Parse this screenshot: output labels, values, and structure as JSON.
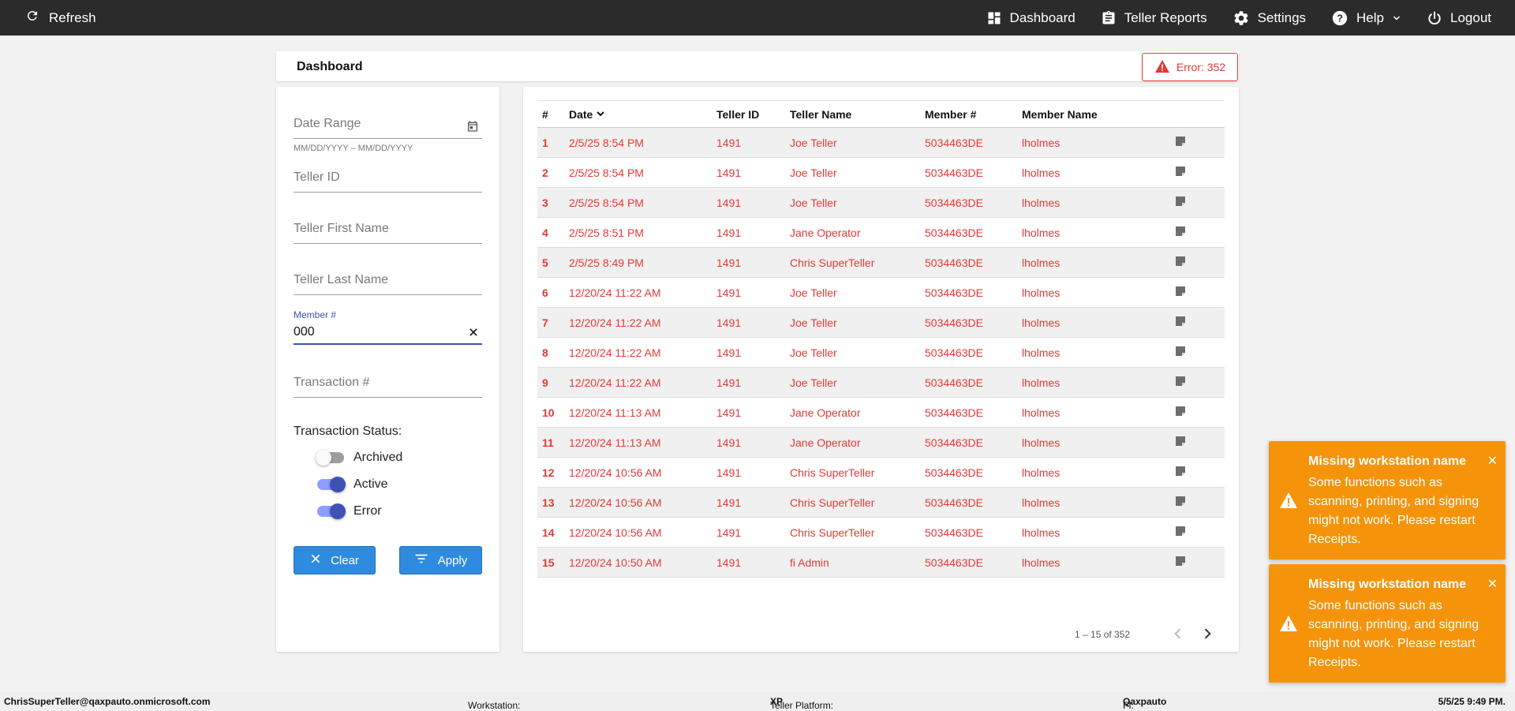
{
  "topbar": {
    "refresh_label": "Refresh",
    "nav": {
      "dashboard": "Dashboard",
      "teller_reports": "Teller Reports",
      "settings": "Settings",
      "help": "Help",
      "logout": "Logout"
    }
  },
  "header": {
    "title": "Dashboard",
    "error_badge": "Error: 352"
  },
  "filters": {
    "date_range_placeholder": "Date Range",
    "date_hint": "MM/DD/YYYY – MM/DD/YYYY",
    "teller_id_placeholder": "Teller ID",
    "teller_first_placeholder": "Teller First Name",
    "teller_last_placeholder": "Teller Last Name",
    "member_label": "Member #",
    "member_value": "000",
    "transaction_placeholder": "Transaction #",
    "status_label": "Transaction Status:",
    "toggles": {
      "archived": {
        "label": "Archived",
        "on": false
      },
      "active": {
        "label": "Active",
        "on": true
      },
      "error": {
        "label": "Error",
        "on": true
      }
    },
    "clear_label": "Clear",
    "apply_label": "Apply"
  },
  "table": {
    "headers": [
      "#",
      "Date",
      "Teller ID",
      "Teller Name",
      "Member #",
      "Member Name"
    ],
    "rows": [
      [
        "1",
        "2/5/25 8:54 PM",
        "1491",
        "Joe Teller",
        "5034463DE",
        "lholmes"
      ],
      [
        "2",
        "2/5/25 8:54 PM",
        "1491",
        "Joe Teller",
        "5034463DE",
        "lholmes"
      ],
      [
        "3",
        "2/5/25 8:54 PM",
        "1491",
        "Joe Teller",
        "5034463DE",
        "lholmes"
      ],
      [
        "4",
        "2/5/25 8:51 PM",
        "1491",
        "Jane Operator",
        "5034463DE",
        "lholmes"
      ],
      [
        "5",
        "2/5/25 8:49 PM",
        "1491",
        "Chris SuperTeller",
        "5034463DE",
        "lholmes"
      ],
      [
        "6",
        "12/20/24 11:22 AM",
        "1491",
        "Joe Teller",
        "5034463DE",
        "lholmes"
      ],
      [
        "7",
        "12/20/24 11:22 AM",
        "1491",
        "Joe Teller",
        "5034463DE",
        "lholmes"
      ],
      [
        "8",
        "12/20/24 11:22 AM",
        "1491",
        "Joe Teller",
        "5034463DE",
        "lholmes"
      ],
      [
        "9",
        "12/20/24 11:22 AM",
        "1491",
        "Joe Teller",
        "5034463DE",
        "lholmes"
      ],
      [
        "10",
        "12/20/24 11:13 AM",
        "1491",
        "Jane Operator",
        "5034463DE",
        "lholmes"
      ],
      [
        "11",
        "12/20/24 11:13 AM",
        "1491",
        "Jane Operator",
        "5034463DE",
        "lholmes"
      ],
      [
        "12",
        "12/20/24 10:56 AM",
        "1491",
        "Chris SuperTeller",
        "5034463DE",
        "lholmes"
      ],
      [
        "13",
        "12/20/24 10:56 AM",
        "1491",
        "Chris SuperTeller",
        "5034463DE",
        "lholmes"
      ],
      [
        "14",
        "12/20/24 10:56 AM",
        "1491",
        "Chris SuperTeller",
        "5034463DE",
        "lholmes"
      ],
      [
        "15",
        "12/20/24 10:50 AM",
        "1491",
        "fi Admin",
        "5034463DE",
        "lholmes"
      ]
    ],
    "row_text_color": "#e53935"
  },
  "pager": {
    "range": "1 – 15 of 352"
  },
  "toasts": [
    {
      "title": "Missing workstation name",
      "message": "Some functions such as scanning, printing, and signing might not work. Please restart Receipts."
    },
    {
      "title": "Missing workstation name",
      "message": "Some functions such as scanning, printing, and signing might not work. Please restart Receipts."
    }
  ],
  "footer": {
    "user": "ChrisSuperTeller@qaxpauto.onmicrosoft.com",
    "workstation_label": "Workstation:",
    "workstation_value": "",
    "platform_label": "Teller Platform:",
    "platform_value": "XP",
    "fi_label": "FI:",
    "fi_value": "Qaxpauto",
    "datetime": "5/5/25 9:49 PM."
  },
  "colors": {
    "topbar": "#2b2b2b",
    "error": "#e53935",
    "toast": "#f5940b",
    "button": "#2e8be0",
    "toggle_on": "#3f51b5"
  }
}
